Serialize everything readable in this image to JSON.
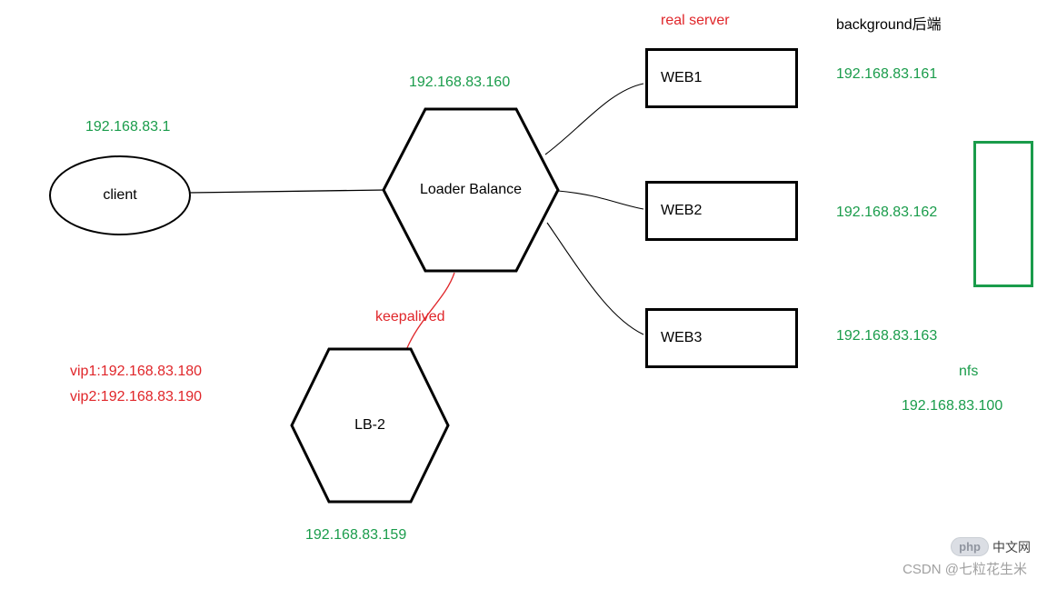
{
  "labels": {
    "client_ip": "192.168.83.1",
    "client": "client",
    "lb_ip": "192.168.83.160",
    "lb": "Loader Balance",
    "keepalived": "keepalived",
    "lb2": "LB-2",
    "lb2_ip": "192.168.83.159",
    "vip1": "vip1:192.168.83.180",
    "vip2": "vip2:192.168.83.190",
    "real_server": "real server",
    "background": "background后端",
    "web1": "WEB1",
    "web1_ip": "192.168.83.161",
    "web2": "WEB2",
    "web2_ip": "192.168.83.162",
    "web3": "WEB3",
    "web3_ip": "192.168.83.163",
    "nfs": "nfs",
    "nfs_ip": "192.168.83.100"
  },
  "chart_data": {
    "type": "diagram",
    "title": "",
    "nodes": [
      {
        "id": "client",
        "label": "client",
        "shape": "ellipse",
        "ip": "192.168.83.1"
      },
      {
        "id": "lb1",
        "label": "Loader Balance",
        "shape": "hexagon",
        "ip": "192.168.83.160"
      },
      {
        "id": "lb2",
        "label": "LB-2",
        "shape": "hexagon",
        "ip": "192.168.83.159"
      },
      {
        "id": "web1",
        "label": "WEB1",
        "shape": "rect",
        "ip": "192.168.83.161",
        "group": "real server / background后端"
      },
      {
        "id": "web2",
        "label": "WEB2",
        "shape": "rect",
        "ip": "192.168.83.162",
        "group": "real server / background后端"
      },
      {
        "id": "web3",
        "label": "WEB3",
        "shape": "rect",
        "ip": "192.168.83.163",
        "group": "real server / background后端"
      },
      {
        "id": "nfs",
        "label": "nfs",
        "shape": "rect-green",
        "ip": "192.168.83.100"
      }
    ],
    "vips": [
      "192.168.83.180",
      "192.168.83.190"
    ],
    "edges": [
      {
        "from": "client",
        "to": "lb1"
      },
      {
        "from": "lb1",
        "to": "web1"
      },
      {
        "from": "lb1",
        "to": "web2"
      },
      {
        "from": "lb1",
        "to": "web3"
      },
      {
        "from": "lb1",
        "to": "lb2",
        "label": "keepalived"
      }
    ]
  },
  "watermarks": {
    "php": "php",
    "php_cn": "中文网",
    "csdn": "CSDN @七粒花生米"
  }
}
